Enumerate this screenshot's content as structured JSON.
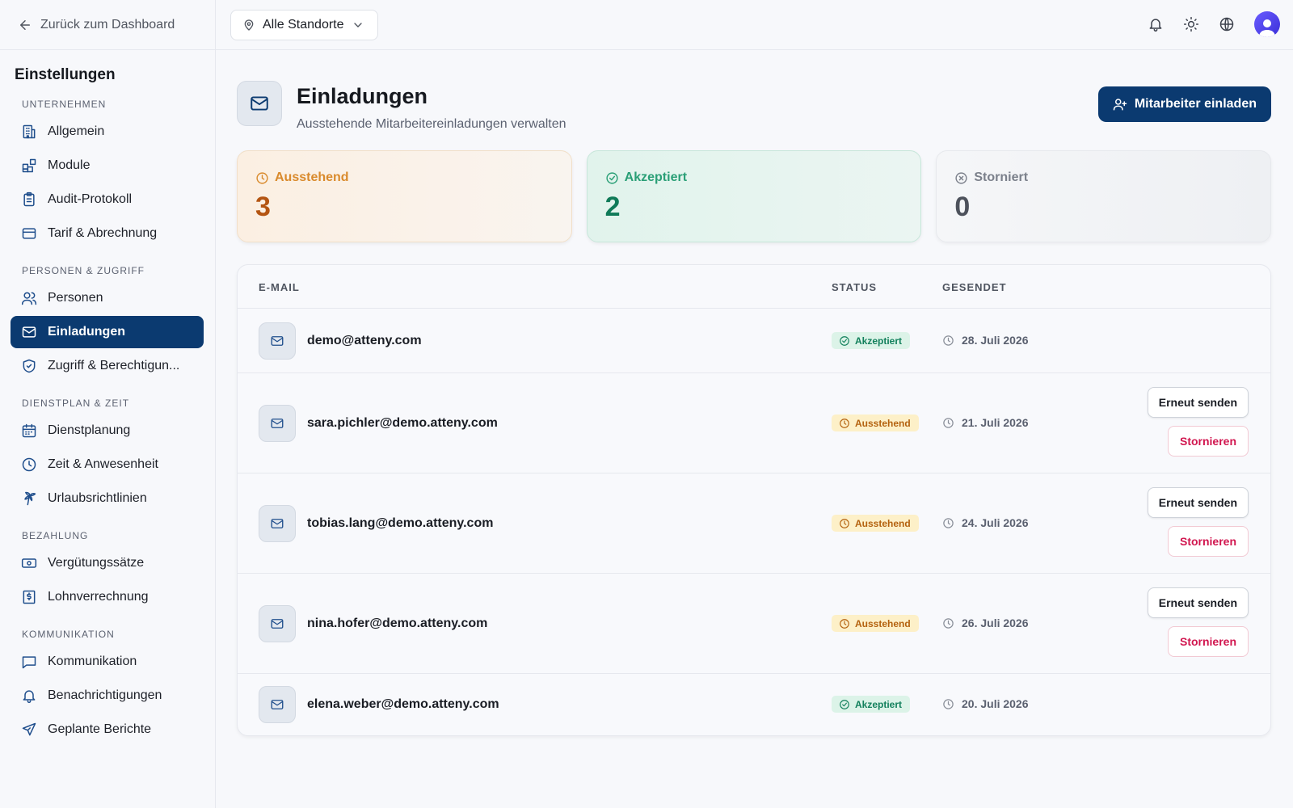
{
  "sidebar": {
    "back_label": "Zurück zum Dashboard",
    "title": "Einstellungen",
    "sections": [
      {
        "label": "UNTERNEHMEN"
      },
      {
        "label": "PERSONEN & ZUGRIFF"
      },
      {
        "label": "DIENSTPLAN & ZEIT"
      },
      {
        "label": "BEZAHLUNG"
      },
      {
        "label": "KOMMUNIKATION"
      }
    ],
    "items": {
      "allgemein": "Allgemein",
      "module": "Module",
      "audit": "Audit-Protokoll",
      "tarif": "Tarif & Abrechnung",
      "personen": "Personen",
      "einladungen": "Einladungen",
      "zugriff": "Zugriff & Berechtigun...",
      "dienstplanung": "Dienstplanung",
      "zeit": "Zeit & Anwesenheit",
      "urlaub": "Urlaubsrichtlinien",
      "verguetung": "Vergütungssätze",
      "lohn": "Lohnverrechnung",
      "kommunikation": "Kommunikation",
      "benachrichtigungen": "Benachrichtigungen",
      "berichte": "Geplante Berichte"
    },
    "active_item": "Einladungen"
  },
  "topbar": {
    "location_select": "Alle Standorte",
    "icons": [
      "bell-icon",
      "sun-icon",
      "globe-icon",
      "avatar"
    ]
  },
  "header": {
    "title": "Einladungen",
    "subtitle": "Ausstehende Mitarbeitereinladungen verwalten",
    "invite_button": "Mitarbeiter einladen"
  },
  "stats": {
    "pending": {
      "label": "Ausstehend",
      "value": "3"
    },
    "accepted": {
      "label": "Akzeptiert",
      "value": "2"
    },
    "cancelled": {
      "label": "Storniert",
      "value": "0"
    }
  },
  "table": {
    "columns": {
      "email": "E-MAIL",
      "status": "STATUS",
      "sent": "GESENDET"
    },
    "rows": [
      {
        "email": "demo@atteny.com",
        "status": "Akzeptiert",
        "sent": "28. Juli 2026"
      },
      {
        "email": "sara.pichler@demo.atteny.com",
        "status": "Ausstehend",
        "sent": "21. Juli 2026",
        "resend": "Erneut senden",
        "cancel": "Stornieren"
      },
      {
        "email": "tobias.lang@demo.atteny.com",
        "status": "Ausstehend",
        "sent": "24. Juli 2026",
        "resend": "Erneut senden",
        "cancel": "Stornieren"
      },
      {
        "email": "nina.hofer@demo.atteny.com",
        "status": "Ausstehend",
        "sent": "26. Juli 2026",
        "resend": "Erneut senden",
        "cancel": "Stornieren"
      },
      {
        "email": "elena.weber@demo.atteny.com",
        "status": "Akzeptiert",
        "sent": "20. Juli 2026"
      }
    ]
  },
  "colors": {
    "primary": "#0b3a70",
    "pending": "#d98a2c",
    "accepted": "#2a9f76",
    "cancel": "#d1164f"
  }
}
